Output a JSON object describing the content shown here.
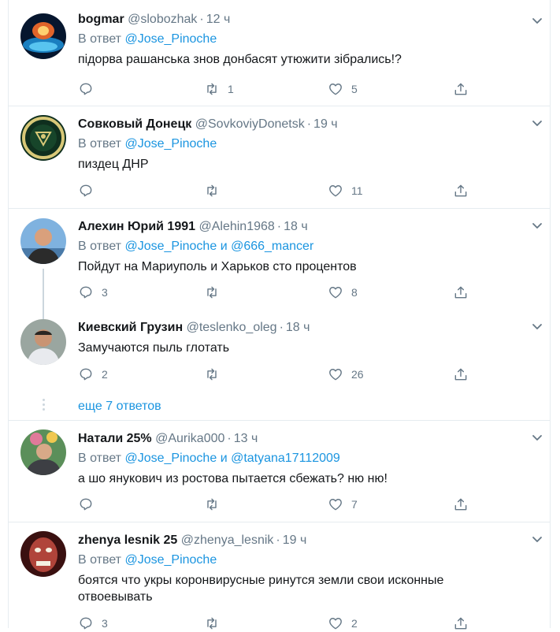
{
  "tweets": [
    {
      "name": "bogmar",
      "handle": "@slobozhak",
      "dot": "·",
      "time": "12 ч",
      "reply_prefix": "В ответ",
      "reply_to_1": "@Jose_Pinoche",
      "text": "підорва рашанська знов донбасят утюжити зібрались!?",
      "replies": "",
      "retweets": "1",
      "likes": "5"
    },
    {
      "name": "Совковый Донецк",
      "handle": "@SovkoviyDonetsk",
      "dot": "·",
      "time": "19 ч",
      "reply_prefix": "В ответ",
      "reply_to_1": "@Jose_Pinoche",
      "text": "пиздец ДНР",
      "replies": "",
      "retweets": "",
      "likes": "11"
    },
    {
      "name": "Алехин Юрий 1991",
      "handle": "@Alehin1968",
      "dot": "·",
      "time": "18 ч",
      "reply_prefix": "В ответ",
      "reply_to_1": "@Jose_Pinoche",
      "reply_and": "и",
      "reply_to_2": "@666_mancer",
      "text": "Пойдут на Мариуполь и Харьков сто процентов",
      "replies": "3",
      "retweets": "",
      "likes": "8"
    },
    {
      "name": "Киевский Грузин",
      "handle": "@teslenko_oleg",
      "dot": "·",
      "time": "18 ч",
      "text": "Замучаются пыль глотать",
      "replies": "2",
      "retweets": "",
      "likes": "26"
    },
    {
      "name": "Натали 25%",
      "handle": "@Aurika000",
      "dot": "·",
      "time": "13 ч",
      "reply_prefix": "В ответ",
      "reply_to_1": "@Jose_Pinoche",
      "reply_and": "и",
      "reply_to_2": "@tatyana17112009",
      "text": "а шо янукович из ростова пытается сбежать? ню ню!",
      "replies": "",
      "retweets": "",
      "likes": "7"
    },
    {
      "name": "zhenya lesnik 25",
      "handle": "@zhenya_lesnik",
      "dot": "·",
      "time": "19 ч",
      "reply_prefix": "В ответ",
      "reply_to_1": "@Jose_Pinoche",
      "text": "боятся что укры коронвирусные ринутся земли свои исконные отвоевывать",
      "replies": "3",
      "retweets": "",
      "likes": "2"
    }
  ],
  "more_replies": "еще 7 ответов",
  "colors": {
    "link": "#1b95e0",
    "muted": "#657786",
    "border": "#e6ecf0",
    "text": "#14171a"
  },
  "icons": [
    "reply-icon",
    "retweet-icon",
    "like-icon",
    "share-icon",
    "chevron-down-icon"
  ]
}
